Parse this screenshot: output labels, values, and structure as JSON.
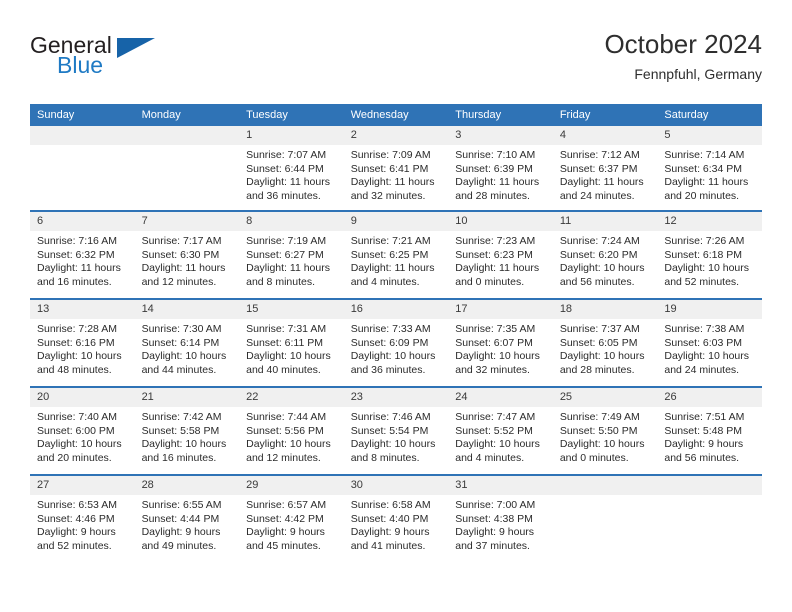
{
  "brand": {
    "name_top": "General",
    "name_bottom": "Blue",
    "color_dark": "#231f20",
    "color_blue": "#1f7ac4",
    "triangle_color": "#1763a8"
  },
  "header": {
    "title": "October 2024",
    "subtitle": "Fennpfuhl, Germany"
  },
  "theme": {
    "header_blue": "#2f73b6",
    "daynum_band": "#f0f0f0",
    "text": "#2b2b2b"
  },
  "weekday_headers": [
    "Sunday",
    "Monday",
    "Tuesday",
    "Wednesday",
    "Thursday",
    "Friday",
    "Saturday"
  ],
  "weeks": [
    [
      {
        "day": "",
        "lines": []
      },
      {
        "day": "",
        "lines": []
      },
      {
        "day": "1",
        "lines": [
          "Sunrise: 7:07 AM",
          "Sunset: 6:44 PM",
          "Daylight: 11 hours",
          "and 36 minutes."
        ]
      },
      {
        "day": "2",
        "lines": [
          "Sunrise: 7:09 AM",
          "Sunset: 6:41 PM",
          "Daylight: 11 hours",
          "and 32 minutes."
        ]
      },
      {
        "day": "3",
        "lines": [
          "Sunrise: 7:10 AM",
          "Sunset: 6:39 PM",
          "Daylight: 11 hours",
          "and 28 minutes."
        ]
      },
      {
        "day": "4",
        "lines": [
          "Sunrise: 7:12 AM",
          "Sunset: 6:37 PM",
          "Daylight: 11 hours",
          "and 24 minutes."
        ]
      },
      {
        "day": "5",
        "lines": [
          "Sunrise: 7:14 AM",
          "Sunset: 6:34 PM",
          "Daylight: 11 hours",
          "and 20 minutes."
        ]
      }
    ],
    [
      {
        "day": "6",
        "lines": [
          "Sunrise: 7:16 AM",
          "Sunset: 6:32 PM",
          "Daylight: 11 hours",
          "and 16 minutes."
        ]
      },
      {
        "day": "7",
        "lines": [
          "Sunrise: 7:17 AM",
          "Sunset: 6:30 PM",
          "Daylight: 11 hours",
          "and 12 minutes."
        ]
      },
      {
        "day": "8",
        "lines": [
          "Sunrise: 7:19 AM",
          "Sunset: 6:27 PM",
          "Daylight: 11 hours",
          "and 8 minutes."
        ]
      },
      {
        "day": "9",
        "lines": [
          "Sunrise: 7:21 AM",
          "Sunset: 6:25 PM",
          "Daylight: 11 hours",
          "and 4 minutes."
        ]
      },
      {
        "day": "10",
        "lines": [
          "Sunrise: 7:23 AM",
          "Sunset: 6:23 PM",
          "Daylight: 11 hours",
          "and 0 minutes."
        ]
      },
      {
        "day": "11",
        "lines": [
          "Sunrise: 7:24 AM",
          "Sunset: 6:20 PM",
          "Daylight: 10 hours",
          "and 56 minutes."
        ]
      },
      {
        "day": "12",
        "lines": [
          "Sunrise: 7:26 AM",
          "Sunset: 6:18 PM",
          "Daylight: 10 hours",
          "and 52 minutes."
        ]
      }
    ],
    [
      {
        "day": "13",
        "lines": [
          "Sunrise: 7:28 AM",
          "Sunset: 6:16 PM",
          "Daylight: 10 hours",
          "and 48 minutes."
        ]
      },
      {
        "day": "14",
        "lines": [
          "Sunrise: 7:30 AM",
          "Sunset: 6:14 PM",
          "Daylight: 10 hours",
          "and 44 minutes."
        ]
      },
      {
        "day": "15",
        "lines": [
          "Sunrise: 7:31 AM",
          "Sunset: 6:11 PM",
          "Daylight: 10 hours",
          "and 40 minutes."
        ]
      },
      {
        "day": "16",
        "lines": [
          "Sunrise: 7:33 AM",
          "Sunset: 6:09 PM",
          "Daylight: 10 hours",
          "and 36 minutes."
        ]
      },
      {
        "day": "17",
        "lines": [
          "Sunrise: 7:35 AM",
          "Sunset: 6:07 PM",
          "Daylight: 10 hours",
          "and 32 minutes."
        ]
      },
      {
        "day": "18",
        "lines": [
          "Sunrise: 7:37 AM",
          "Sunset: 6:05 PM",
          "Daylight: 10 hours",
          "and 28 minutes."
        ]
      },
      {
        "day": "19",
        "lines": [
          "Sunrise: 7:38 AM",
          "Sunset: 6:03 PM",
          "Daylight: 10 hours",
          "and 24 minutes."
        ]
      }
    ],
    [
      {
        "day": "20",
        "lines": [
          "Sunrise: 7:40 AM",
          "Sunset: 6:00 PM",
          "Daylight: 10 hours",
          "and 20 minutes."
        ]
      },
      {
        "day": "21",
        "lines": [
          "Sunrise: 7:42 AM",
          "Sunset: 5:58 PM",
          "Daylight: 10 hours",
          "and 16 minutes."
        ]
      },
      {
        "day": "22",
        "lines": [
          "Sunrise: 7:44 AM",
          "Sunset: 5:56 PM",
          "Daylight: 10 hours",
          "and 12 minutes."
        ]
      },
      {
        "day": "23",
        "lines": [
          "Sunrise: 7:46 AM",
          "Sunset: 5:54 PM",
          "Daylight: 10 hours",
          "and 8 minutes."
        ]
      },
      {
        "day": "24",
        "lines": [
          "Sunrise: 7:47 AM",
          "Sunset: 5:52 PM",
          "Daylight: 10 hours",
          "and 4 minutes."
        ]
      },
      {
        "day": "25",
        "lines": [
          "Sunrise: 7:49 AM",
          "Sunset: 5:50 PM",
          "Daylight: 10 hours",
          "and 0 minutes."
        ]
      },
      {
        "day": "26",
        "lines": [
          "Sunrise: 7:51 AM",
          "Sunset: 5:48 PM",
          "Daylight: 9 hours",
          "and 56 minutes."
        ]
      }
    ],
    [
      {
        "day": "27",
        "lines": [
          "Sunrise: 6:53 AM",
          "Sunset: 4:46 PM",
          "Daylight: 9 hours",
          "and 52 minutes."
        ]
      },
      {
        "day": "28",
        "lines": [
          "Sunrise: 6:55 AM",
          "Sunset: 4:44 PM",
          "Daylight: 9 hours",
          "and 49 minutes."
        ]
      },
      {
        "day": "29",
        "lines": [
          "Sunrise: 6:57 AM",
          "Sunset: 4:42 PM",
          "Daylight: 9 hours",
          "and 45 minutes."
        ]
      },
      {
        "day": "30",
        "lines": [
          "Sunrise: 6:58 AM",
          "Sunset: 4:40 PM",
          "Daylight: 9 hours",
          "and 41 minutes."
        ]
      },
      {
        "day": "31",
        "lines": [
          "Sunrise: 7:00 AM",
          "Sunset: 4:38 PM",
          "Daylight: 9 hours",
          "and 37 minutes."
        ]
      },
      {
        "day": "",
        "lines": []
      },
      {
        "day": "",
        "lines": []
      }
    ]
  ]
}
